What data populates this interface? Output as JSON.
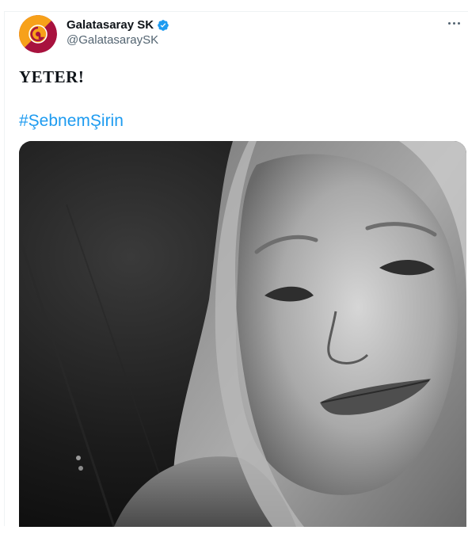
{
  "tweet": {
    "author": {
      "display_name": "Galatasaray SK",
      "handle": "@GalatasaraySK",
      "verified": true,
      "avatar_colors": [
        "#f7a11a",
        "#a8123e"
      ]
    },
    "text": "YETER!",
    "hashtag": "#ŞebnemŞirin",
    "media": {
      "kind": "photo",
      "style": "black-and-white portrait"
    }
  },
  "colors": {
    "link": "#1d9bf0",
    "verified": "#1d9bf0",
    "text": "#0f1419",
    "muted": "#536471"
  },
  "icons": {
    "verified": "verified-badge-icon",
    "more": "more-options-icon"
  }
}
